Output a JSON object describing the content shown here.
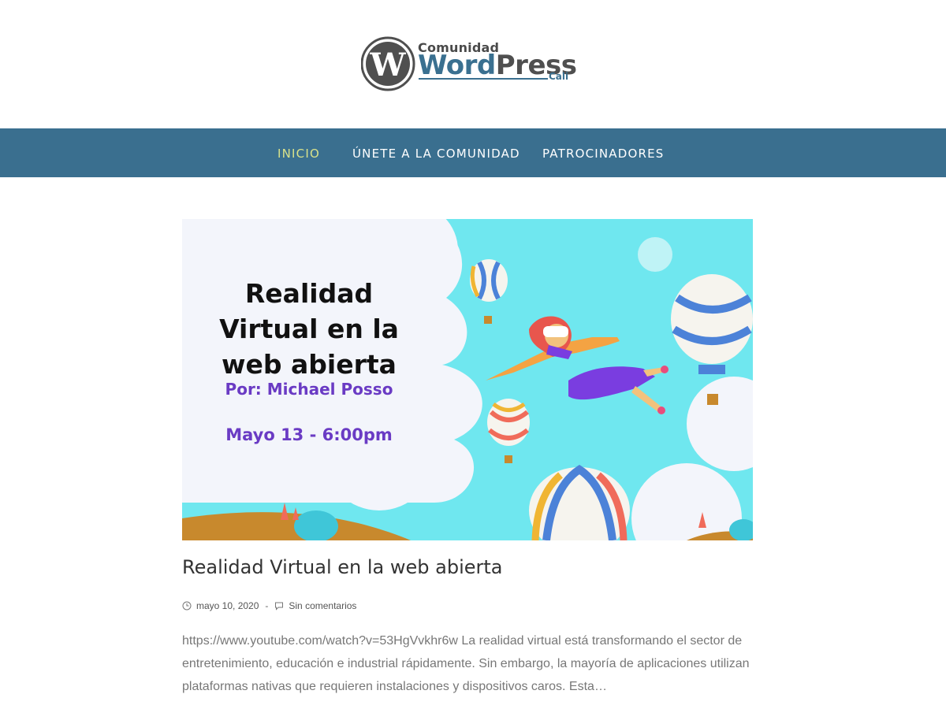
{
  "header": {
    "logo": {
      "comunidad": "Comunidad",
      "word": "Word",
      "press": "Press",
      "cali": "Cali"
    }
  },
  "nav": {
    "items": [
      {
        "label": "INICIO",
        "active": true
      },
      {
        "label": "ÚNETE A LA COMUNIDAD",
        "active": false
      },
      {
        "label": "PATROCINADORES",
        "active": false
      }
    ]
  },
  "featured": {
    "title_lines": [
      "Realidad",
      "Virtual en la",
      "web abierta"
    ],
    "author": "Por: Michael Posso",
    "date": "Mayo 13 - 6:00pm"
  },
  "post": {
    "title": "Realidad Virtual en la web abierta",
    "date": "mayo 10, 2020",
    "separator": "-",
    "comments": "Sin comentarios",
    "excerpt": "https://www.youtube.com/watch?v=53HgVvkhr6w La realidad virtual está transformando el sector de entretenimiento, educación e industrial rápidamente. Sin embargo, la mayoría de aplicaciones utilizan plataformas nativas que requieren instalaciones y dispositivos caros. Esta…"
  },
  "colors": {
    "nav_bg": "#3a6f8f",
    "nav_active": "#d9e28a",
    "brand_blue": "#3a7090",
    "image_sky": "#6fe7ef",
    "image_purple": "#6a3bc4"
  },
  "icons": {
    "date": "clock-icon",
    "comments": "comment-icon"
  }
}
